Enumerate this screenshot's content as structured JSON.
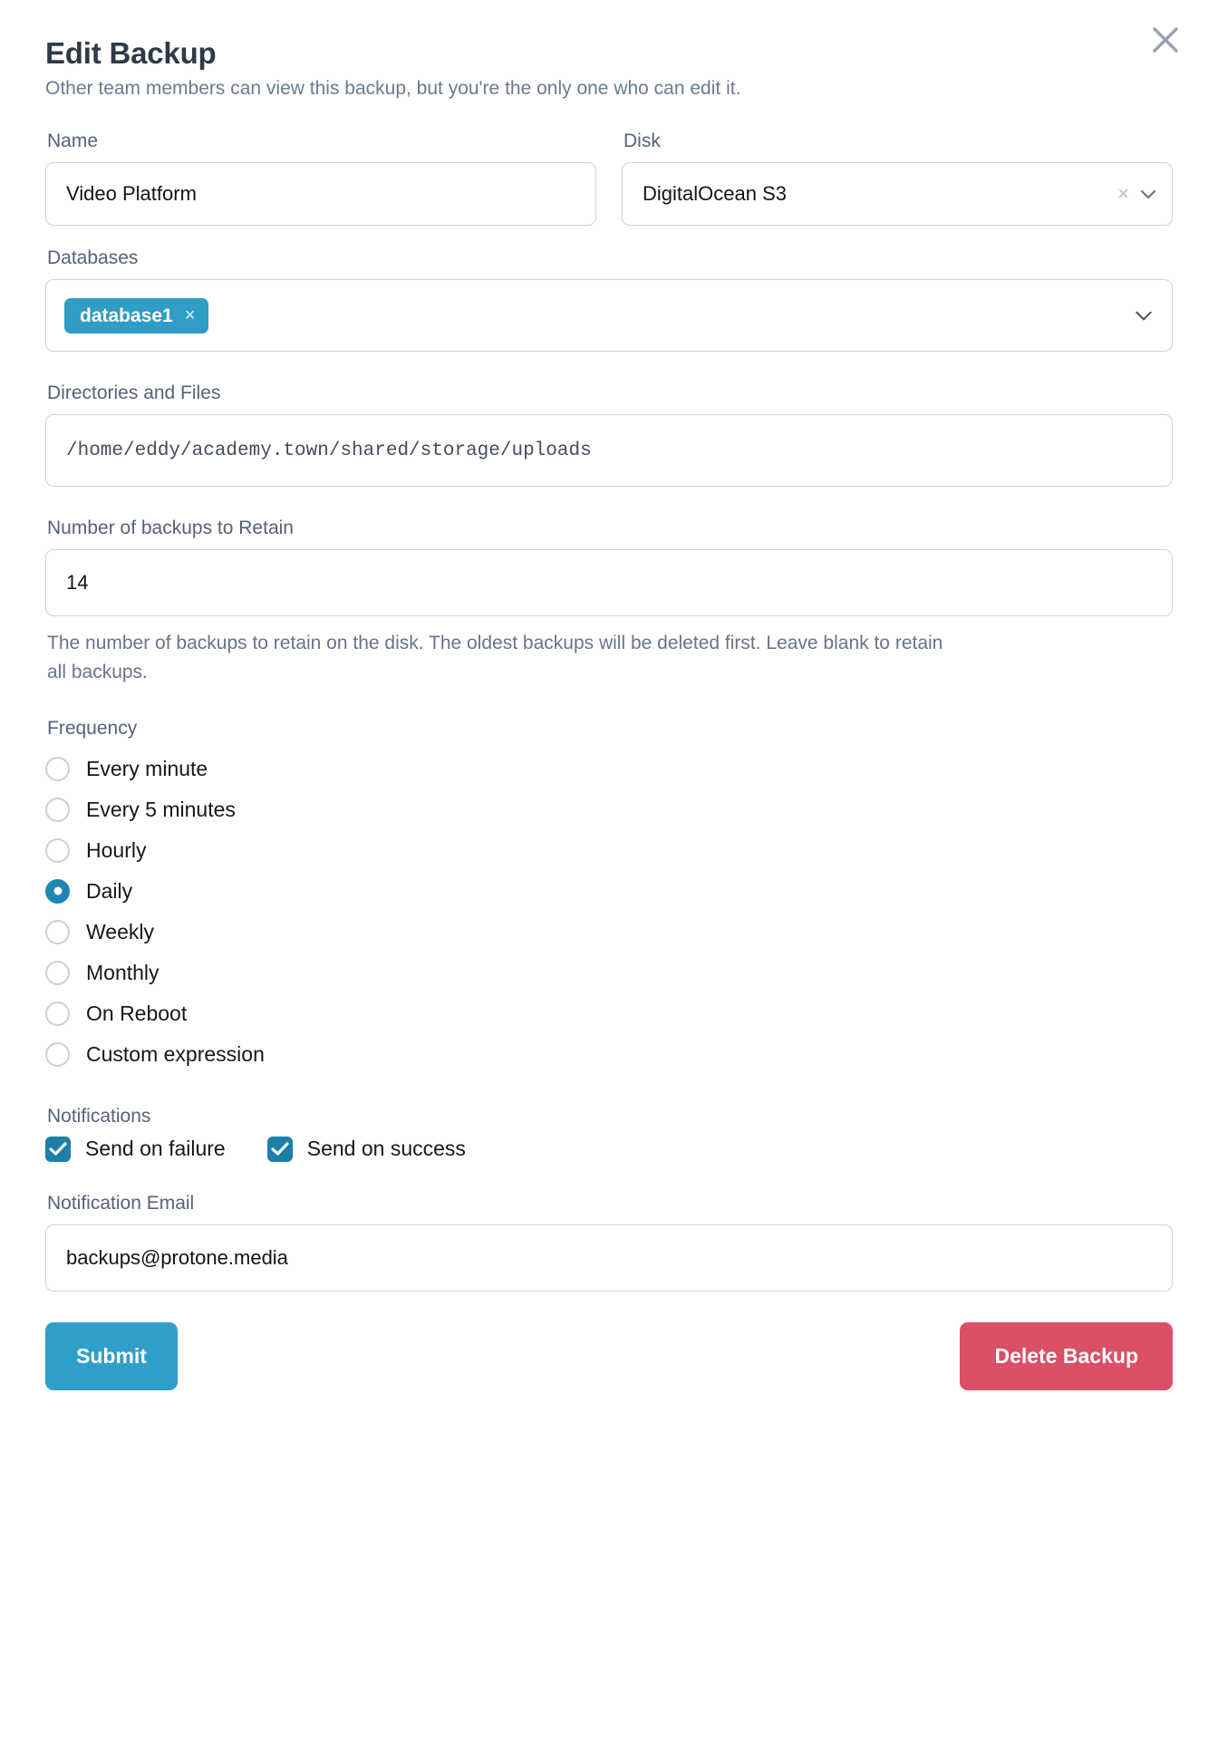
{
  "dialog": {
    "title": "Edit Backup",
    "subtitle": "Other team members can view this backup, but you're the only one who can edit it.",
    "close_label": "×"
  },
  "fields": {
    "name": {
      "label": "Name",
      "value": "Video Platform"
    },
    "disk": {
      "label": "Disk",
      "value": "DigitalOcean S3",
      "clear_glyph": "×"
    },
    "databases": {
      "label": "Databases",
      "tags": [
        {
          "label": "database1",
          "remove_glyph": "×"
        }
      ]
    },
    "directories": {
      "label": "Directories and Files",
      "value": "/home/eddy/academy.town/shared/storage/uploads"
    },
    "retain": {
      "label": "Number of backups to Retain",
      "value": "14",
      "help": "The number of backups to retain on the disk. The oldest backups will be deleted first. Leave blank to retain all backups."
    },
    "notification_email": {
      "label": "Notification Email",
      "value": "backups@protone.media"
    }
  },
  "frequency": {
    "label": "Frequency",
    "selected": "Daily",
    "options": [
      {
        "label": "Every minute",
        "checked": false
      },
      {
        "label": "Every 5 minutes",
        "checked": false
      },
      {
        "label": "Hourly",
        "checked": false
      },
      {
        "label": "Daily",
        "checked": true
      },
      {
        "label": "Weekly",
        "checked": false
      },
      {
        "label": "Monthly",
        "checked": false
      },
      {
        "label": "On Reboot",
        "checked": false
      },
      {
        "label": "Custom expression",
        "checked": false
      }
    ]
  },
  "notifications": {
    "label": "Notifications",
    "options": [
      {
        "label": "Send on failure",
        "checked": true
      },
      {
        "label": "Send on success",
        "checked": true
      }
    ]
  },
  "actions": {
    "submit_label": "Submit",
    "delete_label": "Delete Backup"
  },
  "colors": {
    "accent": "#2e9fc9",
    "tag": "#2f9dc4",
    "radio_selected": "#1b88b4",
    "checkbox": "#1d7fa8",
    "danger": "#da5067",
    "label_text": "#55627a",
    "border": "#ccd2de"
  }
}
